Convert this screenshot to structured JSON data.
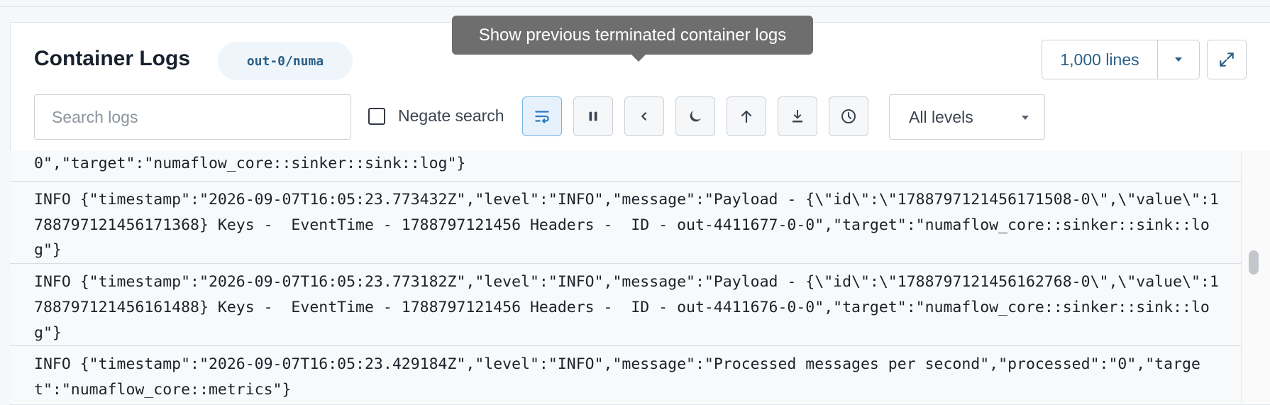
{
  "header": {
    "title": "Container Logs",
    "pod_badge": "out-0/numa",
    "tooltip": "Show previous terminated container logs",
    "lines_label": "1,000 lines"
  },
  "toolbar": {
    "search_placeholder": "Search logs",
    "negate_label": "Negate search",
    "negate_checked": false,
    "levels_selected": "All levels",
    "buttons": [
      {
        "name": "wrap-lines-button",
        "icon": "wrap-text-icon",
        "active": true
      },
      {
        "name": "pause-button",
        "icon": "pause-icon",
        "active": false
      },
      {
        "name": "previous-logs-button",
        "icon": "chevron-left-icon",
        "active": false
      },
      {
        "name": "dark-mode-button",
        "icon": "moon-icon",
        "active": false
      },
      {
        "name": "scroll-top-button",
        "icon": "arrow-up-icon",
        "active": false
      },
      {
        "name": "download-button",
        "icon": "download-icon",
        "active": false
      },
      {
        "name": "timestamps-button",
        "icon": "clock-icon",
        "active": false
      }
    ]
  },
  "logs": [
    "0\",\"target\":\"numaflow_core::sinker::sink::log\"}",
    "INFO {\"timestamp\":\"2026-09-07T16:05:23.773432Z\",\"level\":\"INFO\",\"message\":\"Payload - {\\\"id\\\":\\\"1788797121456171508-0\\\",\\\"value\\\":1788797121456171368} Keys -  EventTime - 1788797121456 Headers -  ID - out-4411677-0-0\",\"target\":\"numaflow_core::sinker::sink::log\"}",
    "INFO {\"timestamp\":\"2026-09-07T16:05:23.773182Z\",\"level\":\"INFO\",\"message\":\"Payload - {\\\"id\\\":\\\"1788797121456162768-0\\\",\\\"value\\\":1788797121456161488} Keys -  EventTime - 1788797121456 Headers -  ID - out-4411676-0-0\",\"target\":\"numaflow_core::sinker::sink::log\"}",
    "INFO {\"timestamp\":\"2026-09-07T16:05:23.429184Z\",\"level\":\"INFO\",\"message\":\"Processed messages per second\",\"processed\":\"0\",\"target\":\"numaflow_core::metrics\"}"
  ],
  "colors": {
    "accent": "#2b5f86",
    "tooltip_bg": "#6e6e6e",
    "active_button_border": "#74b3e3"
  }
}
